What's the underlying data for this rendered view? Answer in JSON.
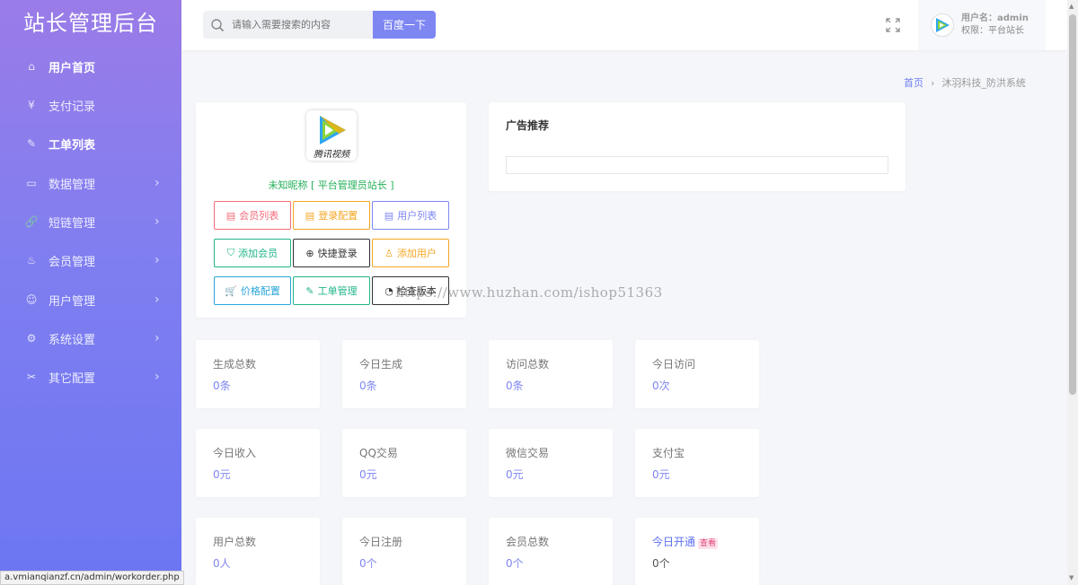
{
  "app": {
    "title": "站长管理后台"
  },
  "sidebar": {
    "items": [
      {
        "label": "用户首页",
        "icon": "home-icon",
        "glyph": "⌂",
        "has_arrow": false,
        "bold": true
      },
      {
        "label": "支付记录",
        "icon": "yen-icon",
        "glyph": "¥",
        "has_arrow": false,
        "bold": false
      },
      {
        "label": "工单列表",
        "icon": "edit-icon",
        "glyph": "✎",
        "has_arrow": false,
        "bold": true
      },
      {
        "label": "数据管理",
        "icon": "calendar-icon",
        "glyph": "▭",
        "has_arrow": true,
        "bold": false
      },
      {
        "label": "短链管理",
        "icon": "link-icon",
        "glyph": "🔗",
        "has_arrow": true,
        "bold": false
      },
      {
        "label": "会员管理",
        "icon": "fire-icon",
        "glyph": "♨",
        "has_arrow": true,
        "bold": false
      },
      {
        "label": "用户管理",
        "icon": "user-icon",
        "glyph": "☺",
        "has_arrow": true,
        "bold": false
      },
      {
        "label": "系统设置",
        "icon": "gear-icon",
        "glyph": "⚙",
        "has_arrow": true,
        "bold": false
      },
      {
        "label": "其它配置",
        "icon": "tools-icon",
        "glyph": "✂",
        "has_arrow": true,
        "bold": false
      }
    ]
  },
  "status_url": "a.vmianqianzf.cn/admin/workorder.php",
  "header": {
    "search_placeholder": "请输入需要搜索的内容",
    "search_button": "百度一下",
    "user_name_label": "用户名：admin",
    "user_role_label": "权限：平台站长"
  },
  "breadcrumb": {
    "home": "首页",
    "current": "沐羽科技_防洪系统"
  },
  "profile": {
    "logo_text": "腾讯视频",
    "nickname": "未知昵称 [ 平台管理员站长 ]",
    "buttons": [
      {
        "label": "会员列表",
        "icon": "doc-icon",
        "glyph": "▤",
        "color": "#f56c7a"
      },
      {
        "label": "登录配置",
        "icon": "doc-icon",
        "glyph": "▤",
        "color": "#f5a623"
      },
      {
        "label": "用户列表",
        "icon": "doc-icon",
        "glyph": "▤",
        "color": "#7e86f2"
      },
      {
        "label": "添加会员",
        "icon": "shield-icon",
        "glyph": "⛉",
        "color": "#20b48a"
      },
      {
        "label": "快捷登录",
        "icon": "plus-circle-icon",
        "glyph": "⊕",
        "color": "#333333"
      },
      {
        "label": "添加用户",
        "icon": "user-icon",
        "glyph": "♙",
        "color": "#f5a623"
      },
      {
        "label": "价格配置",
        "icon": "cart-icon",
        "glyph": "🛒",
        "color": "#2aa6d9"
      },
      {
        "label": "工单管理",
        "icon": "edit-icon",
        "glyph": "✎",
        "color": "#20b48a"
      },
      {
        "label": "检查版本",
        "icon": "gauge-icon",
        "glyph": "◔",
        "color": "#333333"
      }
    ]
  },
  "ad": {
    "title": "广告推荐"
  },
  "stats": [
    {
      "label": "生成总数",
      "value": "0条"
    },
    {
      "label": "今日生成",
      "value": "0条"
    },
    {
      "label": "访问总数",
      "value": "0条"
    },
    {
      "label": "今日访问",
      "value": "0次"
    },
    {
      "label": "今日收入",
      "value": "0元"
    },
    {
      "label": "QQ交易",
      "value": "0元"
    },
    {
      "label": "微信交易",
      "value": "0元"
    },
    {
      "label": "支付宝",
      "value": "0元"
    },
    {
      "label": "用户总数",
      "value": "0人"
    },
    {
      "label": "今日注册",
      "value": "0个"
    },
    {
      "label": "会员总数",
      "value": "0个"
    },
    {
      "label": "今日开通",
      "value": "0个",
      "tag": "查看"
    }
  ],
  "watermark": "https://www.huzhan.com/ishop51363"
}
